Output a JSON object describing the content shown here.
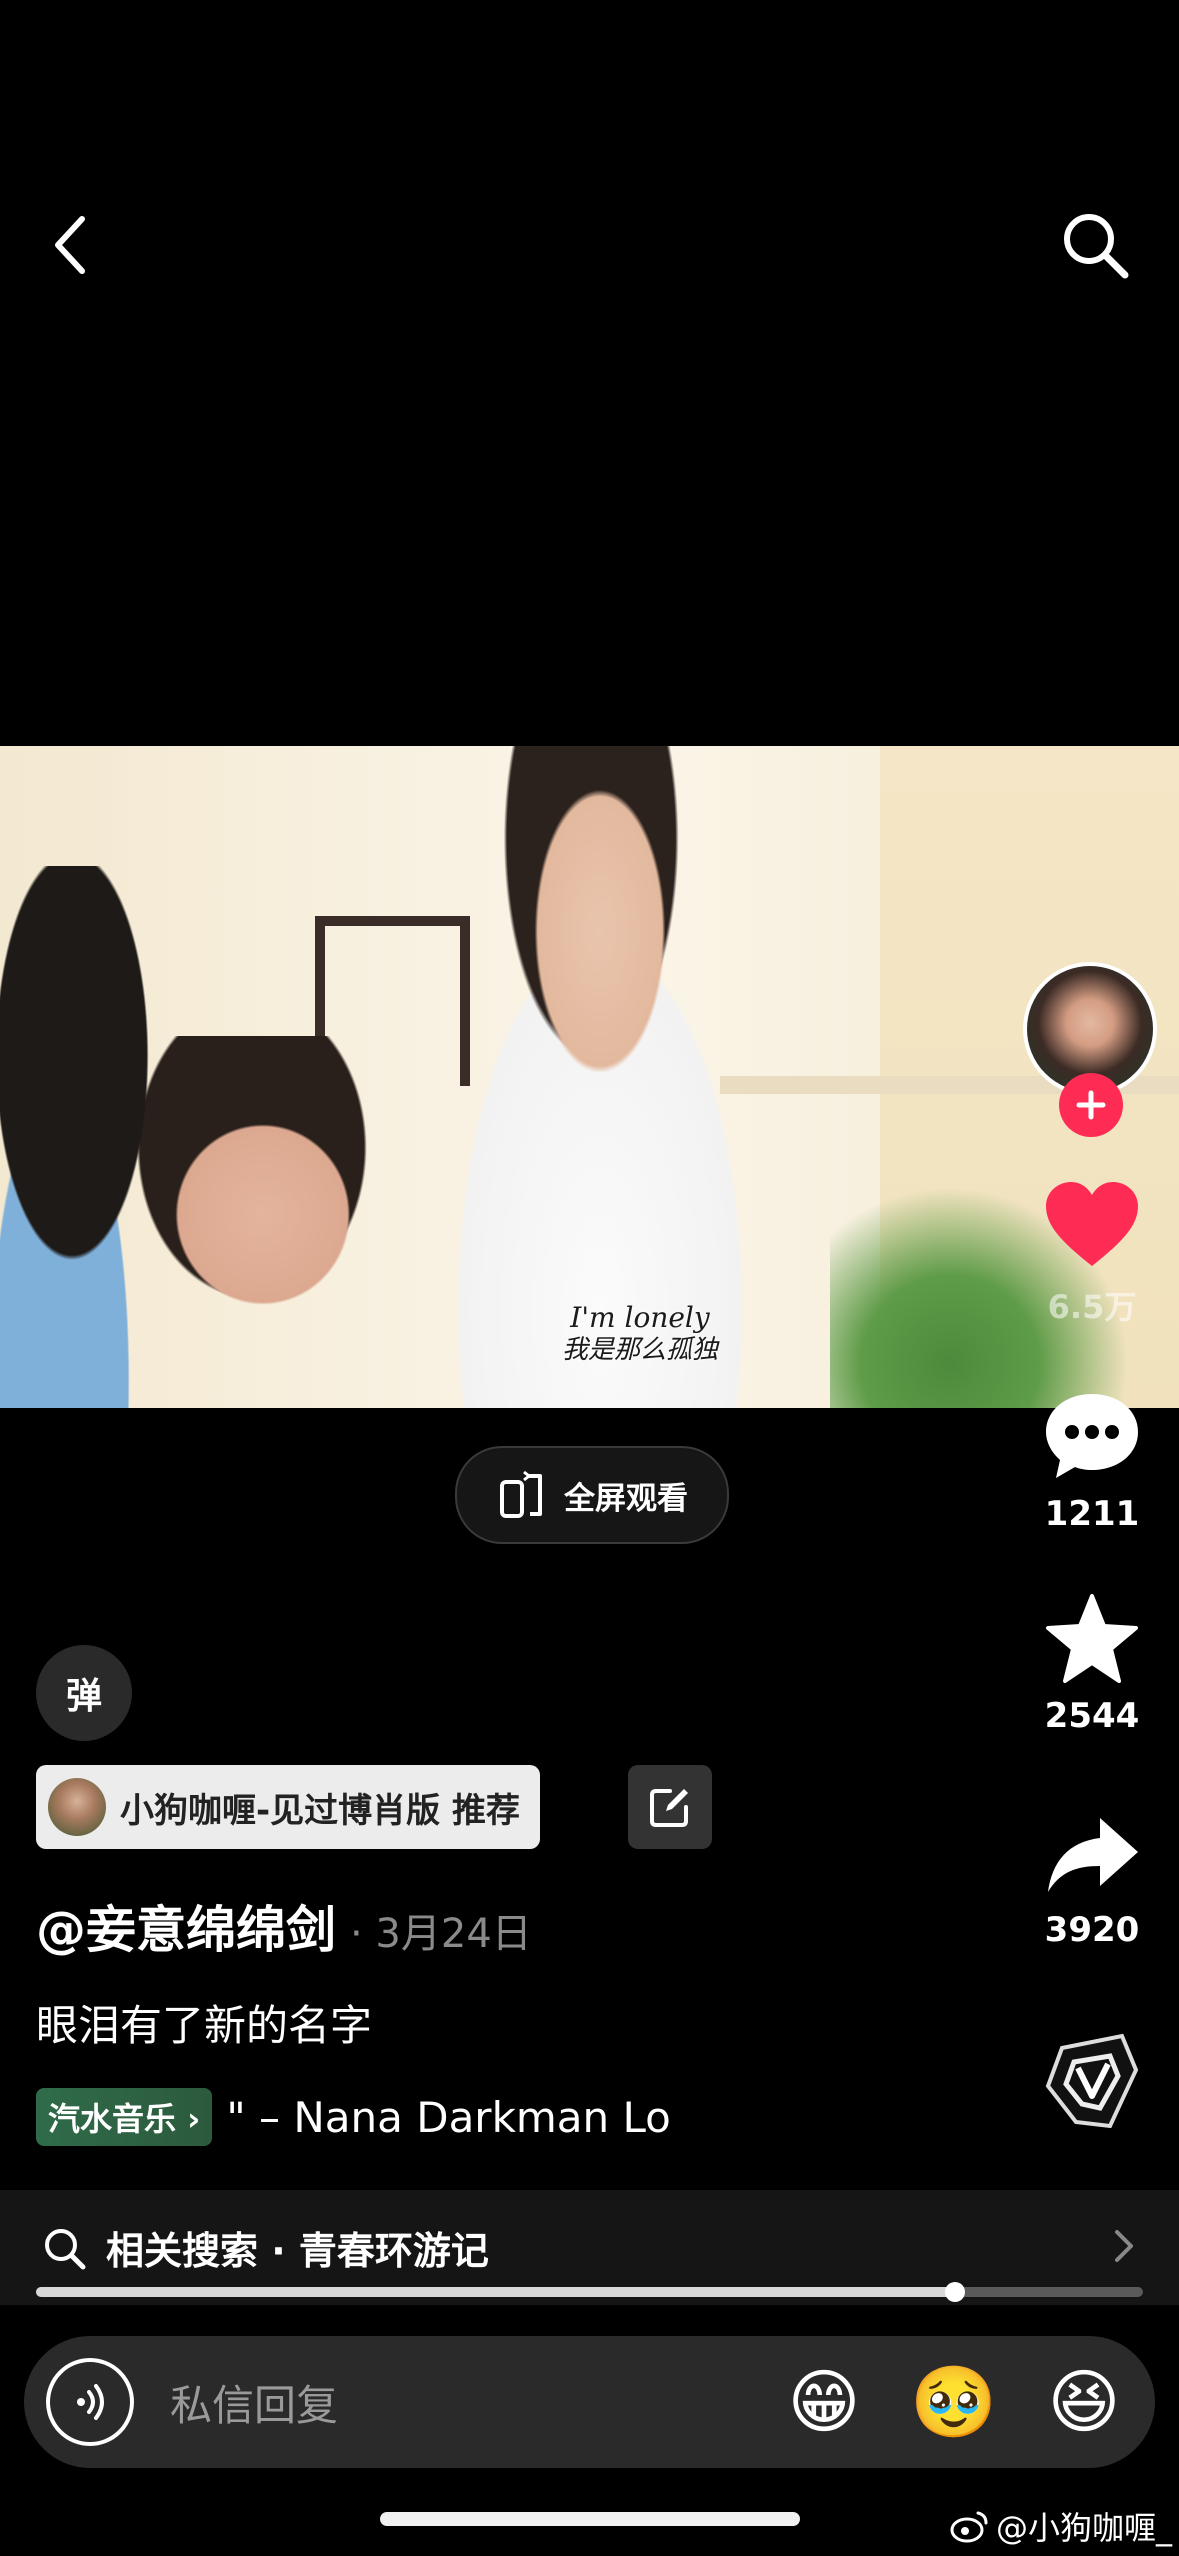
{
  "top_bar": {
    "back_icon": "chevron-left-icon",
    "search_icon": "search-icon"
  },
  "video": {
    "subtitle_en": "I'm lonely",
    "subtitle_zh": "我是那么孤独"
  },
  "fullscreen_label": "全屏观看",
  "right_rail": {
    "like_count": "6.5万",
    "comment_count": "1211",
    "favorite_count": "2544",
    "share_count": "3920"
  },
  "danmaku_label": "弹",
  "collection": {
    "label": "小狗咖喱-见过博肖版 推荐"
  },
  "author": {
    "handle": "@妾意绵绵剑",
    "date": "· 3月24日"
  },
  "description": "眼泪有了新的名字",
  "music": {
    "tag": "汽水音乐 ›",
    "marquee": "\" – Nana Darkman    Lo"
  },
  "related_search": {
    "label": "相关搜索 · 青春环游记"
  },
  "progress": {
    "fraction": 0.83
  },
  "reply": {
    "placeholder": "私信回复",
    "emojis": [
      "😁",
      "🥹",
      "😆"
    ]
  },
  "watermark": "@小狗咖喱_",
  "colors": {
    "like": "#fe2c55",
    "background": "#000000"
  }
}
